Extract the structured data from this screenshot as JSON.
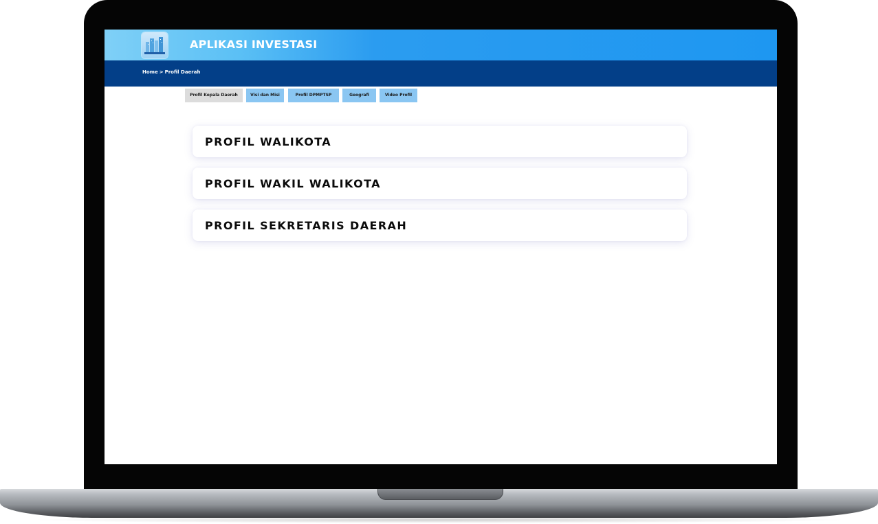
{
  "header": {
    "app_title": "APLIKASI INVESTASI",
    "logo_icon": "city-buildings-logo-icon"
  },
  "breadcrumb": {
    "home": "Home",
    "separator": ">",
    "current": "Profil Daerah"
  },
  "tabs": [
    {
      "label": "Profil Kepala Daerah",
      "active": true
    },
    {
      "label": "Visi dan Misi",
      "active": false
    },
    {
      "label": "Profil DPMPTSP",
      "active": false
    },
    {
      "label": "Geografi",
      "active": false
    },
    {
      "label": "Video Profil",
      "active": false
    }
  ],
  "cards": [
    {
      "title": "PROFIL WALIKOTA"
    },
    {
      "title": "PROFIL WAKIL WALIKOTA"
    },
    {
      "title": "PROFIL SEKRETARIS DAERAH"
    }
  ],
  "colors": {
    "header_gradient_start": "#7fd0f7",
    "header_gradient_end": "#1e97f1",
    "navbar": "#033f88",
    "tab_inactive": "#8ac6f2",
    "tab_active": "#dcdcdc"
  }
}
